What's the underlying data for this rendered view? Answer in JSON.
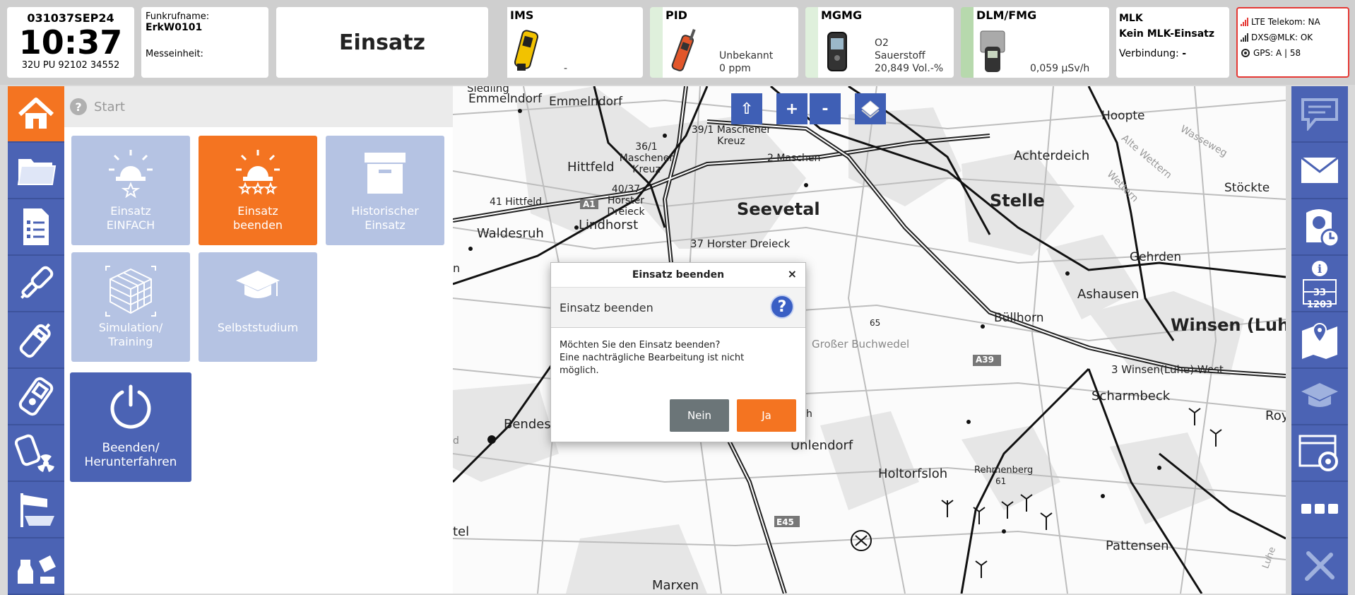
{
  "header": {
    "date": "031037SEP24",
    "time": "10:37",
    "coordinates": "32U PU 92102 34552",
    "radio_name_label": "Funkrufname:",
    "radio_name": "ErkW0101",
    "measuring_unit_label": "Messeinheit:",
    "mode": "Einsatz",
    "devices": [
      {
        "name": "IMS",
        "value_lines": [
          "-"
        ]
      },
      {
        "name": "PID",
        "value_lines": [
          "Unbekannt",
          "0 ppm"
        ]
      },
      {
        "name": "MGMG",
        "value_lines": [
          "O2",
          "Sauerstoff",
          "20,849 Vol.-%"
        ]
      },
      {
        "name": "DLM/FMG",
        "value_lines": [
          "0,059 µSv/h"
        ]
      }
    ],
    "mlk": {
      "title": "MLK",
      "state": "Kein MLK-Einsatz",
      "connection_label": "Verbindung:",
      "connection_value": "-"
    },
    "status": {
      "lte": "LTE Telekom: NA",
      "dxs": "DXS@MLK:  OK",
      "gps": "GPS:  A | 58",
      "border_color": "#e53935"
    }
  },
  "breadcrumb": {
    "label": "Start",
    "help_icon": "?"
  },
  "tiles": [
    {
      "label": "Einsatz\nEINFACH",
      "icon": "siren-star-icon"
    },
    {
      "label": "Einsatz\nbeenden",
      "icon": "siren-stars-icon",
      "active": true
    },
    {
      "label": "Historischer\nEinsatz",
      "icon": "archive-box-icon"
    },
    {
      "label": "Simulation/\nTraining",
      "icon": "cube-icon"
    },
    {
      "label": "Selbststudium",
      "icon": "graduation-cap-icon"
    },
    {
      "label": "Beenden/\nHerunterfahren",
      "icon": "power-icon"
    }
  ],
  "left_nav": [
    "home-icon",
    "folder-icon",
    "checklist-icon",
    "probe-icon",
    "pid-device-icon",
    "meter-icon",
    "radiation-meter-icon",
    "windsock-icon",
    "chemicals-icon"
  ],
  "right_nav": [
    "chat-icon",
    "mail-icon",
    "suit-clock-icon",
    "info-number-icon",
    "map-pin-icon",
    "graduation-cap-icon",
    "settings-window-icon",
    "more-icon",
    "tools-icon"
  ],
  "right_nav_info_numbers": [
    "33",
    "1203"
  ],
  "map": {
    "controls": [
      "⇧",
      "+",
      "-"
    ],
    "labels": {
      "siedling": "Siedling",
      "emmelndorf_w": "Emmelndorf",
      "emmelndorf": "Emmelndorf",
      "hittfeld": "Hittfeld",
      "hittfeld_exit": "41 Hittfeld",
      "maschener_kreuz": "36/1 Maschener Kreuz",
      "maschener_kreuz2": "39/1 Maschener Kreuz",
      "maschen": "2 Maschen",
      "horster_dreieck": "40/37 Horster Dreieck",
      "seevetal": "Seevetal",
      "a1": "A1",
      "waldesruh": "Waldesruh",
      "lindhorst": "Lindhorst",
      "horster_dreieck2": "37 Horster Dreieck",
      "stelle": "Stelle",
      "achterdeich": "Achterdeich",
      "hoopte": "Hoopte",
      "stoeckte": "Stöckte",
      "gehrden": "Gehrden",
      "ashausen": "Ashausen",
      "buellhorn": "Büllhorn",
      "winsen": "Winsen (Luhe)",
      "a39": "A39",
      "winsen_west": "3 Winsen(Luhe)-West",
      "scharmbeck": "Scharmbeck",
      "roy": "Roy",
      "grosser_buchwedel": "Großer Buchwedel",
      "height65": "65",
      "bendes": "Bendes",
      "unlendorf": "Unlendorf",
      "holtorfsloh": "Holtorfsloh",
      "rehmenberg": "Rehmenberg",
      "height61": "61",
      "e45": "E45",
      "pattensen": "Pattensen",
      "marxen": "Marxen",
      "tel": "tel",
      "n_left": "n",
      "d_left": "d",
      "h_behind": "h",
      "alte_wettern": "Alte Wettern",
      "wetter": "Wettern",
      "wasseweg": "Wasseweg",
      "luhe": "Luhe"
    }
  },
  "dialog": {
    "title": "Einsatz beenden",
    "close": "×",
    "heading": "Einsatz beenden",
    "help": "?",
    "message": "Möchten Sie den Einsatz beenden?\nEine nachträgliche Bearbeitung ist nicht möglich.",
    "no_label": "Nein",
    "yes_label": "Ja"
  },
  "colors": {
    "accent": "#f47421",
    "nav_blue": "#4b63b4",
    "tile_light": "#b5c3e3",
    "button_grey": "#6b7578"
  }
}
